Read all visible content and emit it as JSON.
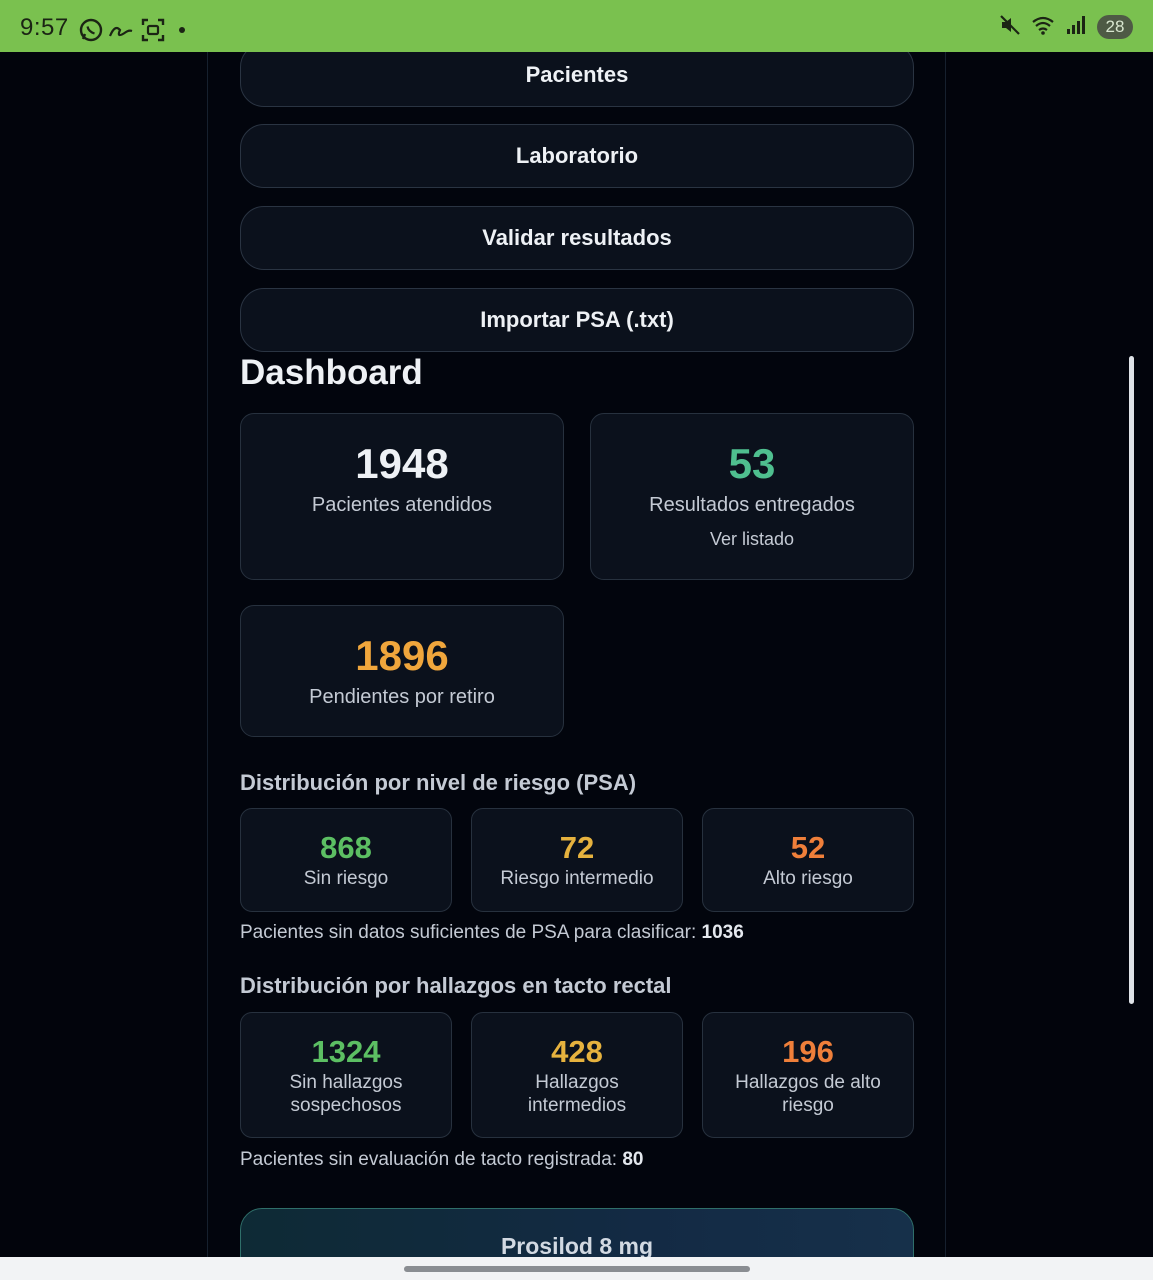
{
  "status_bar": {
    "time": "9:57",
    "battery": "28",
    "left_icons": [
      "whatsapp-icon",
      "signature-app-icon",
      "screen-capture-icon",
      "dot-icon"
    ],
    "right_icons": [
      "mute-icon",
      "wifi-icon",
      "signal-icon",
      "battery-icon"
    ]
  },
  "nav": {
    "buttons": [
      {
        "label": "Pacientes"
      },
      {
        "label": "Laboratorio"
      },
      {
        "label": "Validar resultados"
      },
      {
        "label": "Importar PSA (.txt)"
      }
    ]
  },
  "dashboard": {
    "title": "Dashboard",
    "cards": [
      {
        "value": "1948",
        "label": "Pacientes atendidos",
        "color": "#eef1f5"
      },
      {
        "value": "53",
        "label": "Resultados entregados",
        "link": "Ver listado",
        "color": "#4fbf8f"
      },
      {
        "value": "1896",
        "label": "Pendientes por retiro",
        "color": "#f0a63c"
      }
    ]
  },
  "risk": {
    "title": "Distribución por nivel de riesgo (PSA)",
    "items": [
      {
        "value": "868",
        "label": "Sin riesgo",
        "color": "#5cbf63"
      },
      {
        "value": "72",
        "label": "Riesgo intermedio",
        "color": "#e6b23e"
      },
      {
        "value": "52",
        "label": "Alto riesgo",
        "color": "#ef7f3a"
      }
    ],
    "note_text": "Pacientes sin datos suficientes de PSA para clasificar: ",
    "note_value": "1036"
  },
  "tacto": {
    "title": "Distribución por hallazgos en tacto rectal",
    "items": [
      {
        "value": "1324",
        "label": "Sin hallazgos sospechosos",
        "color": "#5cbf63"
      },
      {
        "value": "428",
        "label": "Hallazgos intermedios",
        "color": "#e6b23e"
      },
      {
        "value": "196",
        "label": "Hallazgos de alto riesgo",
        "color": "#ef7f3a"
      }
    ],
    "note_text": "Pacientes sin evaluación de tacto registrada: ",
    "note_value": "80"
  },
  "promo": {
    "label": "Prosilod 8 mg"
  }
}
